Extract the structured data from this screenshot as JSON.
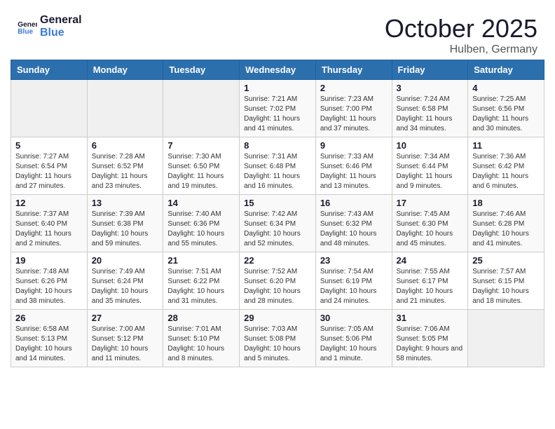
{
  "logo": {
    "text_general": "General",
    "text_blue": "Blue"
  },
  "header": {
    "month": "October 2025",
    "location": "Hulben, Germany"
  },
  "weekdays": [
    "Sunday",
    "Monday",
    "Tuesday",
    "Wednesday",
    "Thursday",
    "Friday",
    "Saturday"
  ],
  "weeks": [
    {
      "days": [
        {
          "num": "",
          "empty": true
        },
        {
          "num": "",
          "empty": true
        },
        {
          "num": "",
          "empty": true
        },
        {
          "num": "1",
          "sunrise": "7:21 AM",
          "sunset": "7:02 PM",
          "daylight": "11 hours and 41 minutes."
        },
        {
          "num": "2",
          "sunrise": "7:23 AM",
          "sunset": "7:00 PM",
          "daylight": "11 hours and 37 minutes."
        },
        {
          "num": "3",
          "sunrise": "7:24 AM",
          "sunset": "6:58 PM",
          "daylight": "11 hours and 34 minutes."
        },
        {
          "num": "4",
          "sunrise": "7:25 AM",
          "sunset": "6:56 PM",
          "daylight": "11 hours and 30 minutes."
        }
      ]
    },
    {
      "days": [
        {
          "num": "5",
          "sunrise": "7:27 AM",
          "sunset": "6:54 PM",
          "daylight": "11 hours and 27 minutes."
        },
        {
          "num": "6",
          "sunrise": "7:28 AM",
          "sunset": "6:52 PM",
          "daylight": "11 hours and 23 minutes."
        },
        {
          "num": "7",
          "sunrise": "7:30 AM",
          "sunset": "6:50 PM",
          "daylight": "11 hours and 19 minutes."
        },
        {
          "num": "8",
          "sunrise": "7:31 AM",
          "sunset": "6:48 PM",
          "daylight": "11 hours and 16 minutes."
        },
        {
          "num": "9",
          "sunrise": "7:33 AM",
          "sunset": "6:46 PM",
          "daylight": "11 hours and 13 minutes."
        },
        {
          "num": "10",
          "sunrise": "7:34 AM",
          "sunset": "6:44 PM",
          "daylight": "11 hours and 9 minutes."
        },
        {
          "num": "11",
          "sunrise": "7:36 AM",
          "sunset": "6:42 PM",
          "daylight": "11 hours and 6 minutes."
        }
      ]
    },
    {
      "days": [
        {
          "num": "12",
          "sunrise": "7:37 AM",
          "sunset": "6:40 PM",
          "daylight": "11 hours and 2 minutes."
        },
        {
          "num": "13",
          "sunrise": "7:39 AM",
          "sunset": "6:38 PM",
          "daylight": "10 hours and 59 minutes."
        },
        {
          "num": "14",
          "sunrise": "7:40 AM",
          "sunset": "6:36 PM",
          "daylight": "10 hours and 55 minutes."
        },
        {
          "num": "15",
          "sunrise": "7:42 AM",
          "sunset": "6:34 PM",
          "daylight": "10 hours and 52 minutes."
        },
        {
          "num": "16",
          "sunrise": "7:43 AM",
          "sunset": "6:32 PM",
          "daylight": "10 hours and 48 minutes."
        },
        {
          "num": "17",
          "sunrise": "7:45 AM",
          "sunset": "6:30 PM",
          "daylight": "10 hours and 45 minutes."
        },
        {
          "num": "18",
          "sunrise": "7:46 AM",
          "sunset": "6:28 PM",
          "daylight": "10 hours and 41 minutes."
        }
      ]
    },
    {
      "days": [
        {
          "num": "19",
          "sunrise": "7:48 AM",
          "sunset": "6:26 PM",
          "daylight": "10 hours and 38 minutes."
        },
        {
          "num": "20",
          "sunrise": "7:49 AM",
          "sunset": "6:24 PM",
          "daylight": "10 hours and 35 minutes."
        },
        {
          "num": "21",
          "sunrise": "7:51 AM",
          "sunset": "6:22 PM",
          "daylight": "10 hours and 31 minutes."
        },
        {
          "num": "22",
          "sunrise": "7:52 AM",
          "sunset": "6:20 PM",
          "daylight": "10 hours and 28 minutes."
        },
        {
          "num": "23",
          "sunrise": "7:54 AM",
          "sunset": "6:19 PM",
          "daylight": "10 hours and 24 minutes."
        },
        {
          "num": "24",
          "sunrise": "7:55 AM",
          "sunset": "6:17 PM",
          "daylight": "10 hours and 21 minutes."
        },
        {
          "num": "25",
          "sunrise": "7:57 AM",
          "sunset": "6:15 PM",
          "daylight": "10 hours and 18 minutes."
        }
      ]
    },
    {
      "days": [
        {
          "num": "26",
          "sunrise": "6:58 AM",
          "sunset": "5:13 PM",
          "daylight": "10 hours and 14 minutes."
        },
        {
          "num": "27",
          "sunrise": "7:00 AM",
          "sunset": "5:12 PM",
          "daylight": "10 hours and 11 minutes."
        },
        {
          "num": "28",
          "sunrise": "7:01 AM",
          "sunset": "5:10 PM",
          "daylight": "10 hours and 8 minutes."
        },
        {
          "num": "29",
          "sunrise": "7:03 AM",
          "sunset": "5:08 PM",
          "daylight": "10 hours and 5 minutes."
        },
        {
          "num": "30",
          "sunrise": "7:05 AM",
          "sunset": "5:06 PM",
          "daylight": "10 hours and 1 minute."
        },
        {
          "num": "31",
          "sunrise": "7:06 AM",
          "sunset": "5:05 PM",
          "daylight": "9 hours and 58 minutes."
        },
        {
          "num": "",
          "empty": true
        }
      ]
    }
  ]
}
